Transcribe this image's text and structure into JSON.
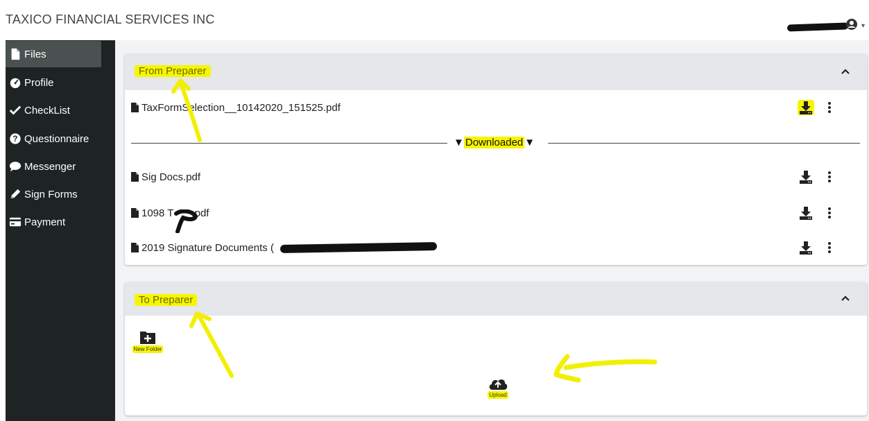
{
  "app": {
    "title": "TAXICO FINANCIAL SERVICES INC"
  },
  "header": {
    "user_menu_icon": "user-circle-icon",
    "caret_icon": "caret-down-icon"
  },
  "sidebar": {
    "items": [
      {
        "label": "Files",
        "icon": "file-icon",
        "active": true
      },
      {
        "label": "Profile",
        "icon": "dashboard-icon",
        "active": false
      },
      {
        "label": "CheckList",
        "icon": "check-icon",
        "active": false
      },
      {
        "label": "Questionnaire",
        "icon": "question-circle-icon",
        "active": false
      },
      {
        "label": "Messenger",
        "icon": "comment-icon",
        "active": false
      },
      {
        "label": "Sign Forms",
        "icon": "pencil-icon",
        "active": false
      },
      {
        "label": "Payment",
        "icon": "credit-card-icon",
        "active": false
      }
    ]
  },
  "from_preparer": {
    "title": "From Preparer",
    "new_files": [
      {
        "name": "TaxFormSelection__10142020_151525.pdf"
      }
    ],
    "divider_label": "Downloaded",
    "downloaded_files": [
      {
        "name": "Sig Docs.pdf"
      },
      {
        "name_prefix": "1098 T",
        "name_suffix": ".pdf"
      },
      {
        "name_prefix": "2019 Signature Documents ("
      }
    ]
  },
  "to_preparer": {
    "title": "To Preparer",
    "new_folder_label": "New Folder",
    "upload_label": "Upload"
  },
  "colors": {
    "sidebar_bg": "#1e2424",
    "sidebar_active": "#4b5150",
    "highlight": "#f7f500",
    "panel_header": "#e5e7ea",
    "main_bg": "#f2f3f4"
  }
}
